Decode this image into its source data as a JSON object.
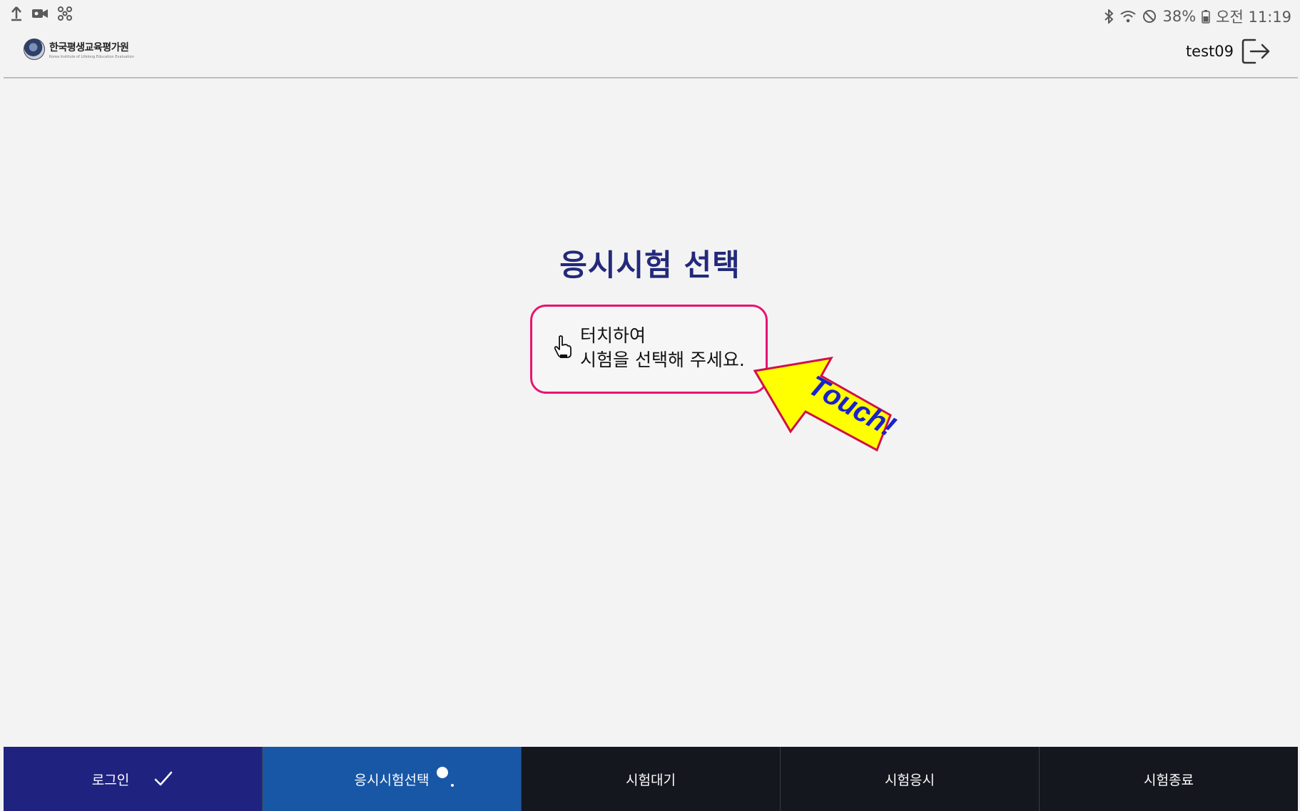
{
  "status_bar": {
    "battery": "38%",
    "time": "오전 11:19",
    "left_icons": [
      "upload-icon",
      "video-camera-icon",
      "fan-icon"
    ],
    "right_icons": [
      "bluetooth-icon",
      "wifi-icon",
      "do-not-disturb-icon",
      "battery-icon"
    ]
  },
  "header": {
    "logo_text": "한국평생교육평가원",
    "logo_subtext": "Korea Institute of Lifelong Education Evaluation",
    "username": "test09",
    "logout_icon": "logout-icon"
  },
  "main": {
    "title": "응시시험 선택",
    "prompt_line1": "터치하여",
    "prompt_line2": "시험을 선택해 주세요.",
    "touch_label": "Touch!",
    "colors": {
      "title": "#23297a",
      "box_border": "#e8146f",
      "arrow_fill": "#ffff00",
      "arrow_stroke": "#d0104a",
      "touch_text": "#1a22c9"
    }
  },
  "steps": [
    {
      "label": "로그인",
      "state": "done"
    },
    {
      "label": "응시시험선택",
      "state": "active"
    },
    {
      "label": "시험대기",
      "state": "pending"
    },
    {
      "label": "시험응시",
      "state": "pending"
    },
    {
      "label": "시험종료",
      "state": "pending"
    }
  ]
}
